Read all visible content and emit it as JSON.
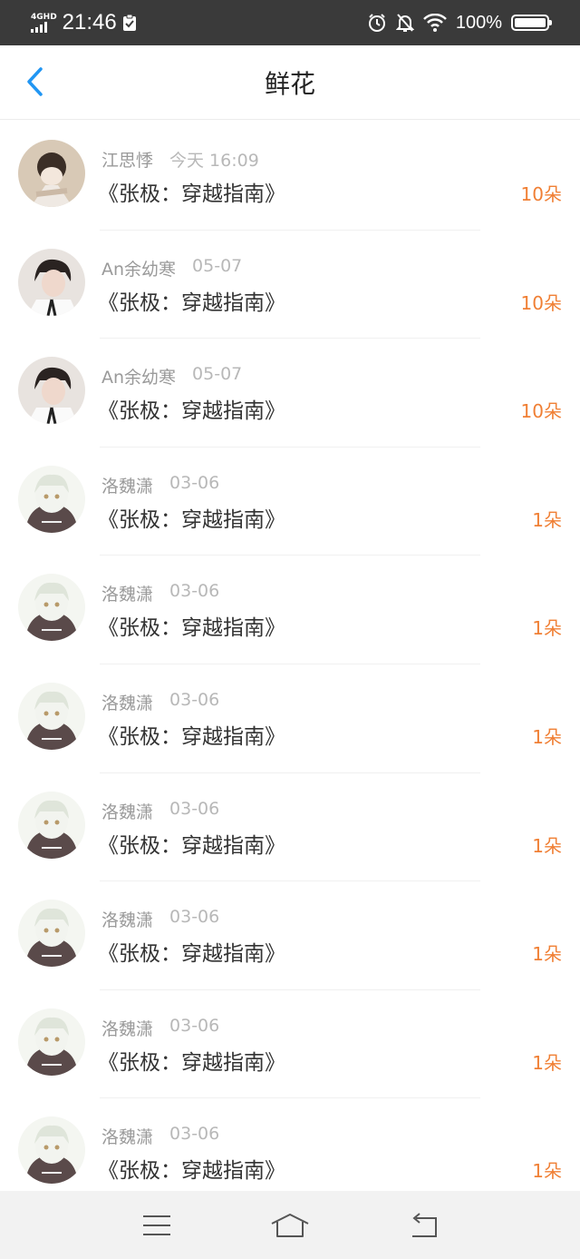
{
  "status_bar": {
    "network": "4G",
    "network_suffix": "HD",
    "time": "21:46",
    "battery": "100%"
  },
  "header": {
    "title": "鲜花"
  },
  "items": [
    {
      "user": "江思悸",
      "date": "今天 16:09",
      "book": "《张极：穿越指南》",
      "amount": "10朵",
      "avatar": "avatar-1"
    },
    {
      "user": "An余幼寒",
      "date": "05-07",
      "book": "《张极：穿越指南》",
      "amount": "10朵",
      "avatar": "avatar-2"
    },
    {
      "user": "An余幼寒",
      "date": "05-07",
      "book": "《张极：穿越指南》",
      "amount": "10朵",
      "avatar": "avatar-2"
    },
    {
      "user": "洛魏潇",
      "date": "03-06",
      "book": "《张极：穿越指南》",
      "amount": "1朵",
      "avatar": "avatar-3"
    },
    {
      "user": "洛魏潇",
      "date": "03-06",
      "book": "《张极：穿越指南》",
      "amount": "1朵",
      "avatar": "avatar-3"
    },
    {
      "user": "洛魏潇",
      "date": "03-06",
      "book": "《张极：穿越指南》",
      "amount": "1朵",
      "avatar": "avatar-3"
    },
    {
      "user": "洛魏潇",
      "date": "03-06",
      "book": "《张极：穿越指南》",
      "amount": "1朵",
      "avatar": "avatar-3"
    },
    {
      "user": "洛魏潇",
      "date": "03-06",
      "book": "《张极：穿越指南》",
      "amount": "1朵",
      "avatar": "avatar-3"
    },
    {
      "user": "洛魏潇",
      "date": "03-06",
      "book": "《张极：穿越指南》",
      "amount": "1朵",
      "avatar": "avatar-3"
    },
    {
      "user": "洛魏潇",
      "date": "03-06",
      "book": "《张极：穿越指南》",
      "amount": "1朵",
      "avatar": "avatar-3"
    }
  ],
  "colors": {
    "accent_blue": "#2196f3",
    "amount_orange": "#f07f34",
    "status_bar_bg": "#3a3a3a"
  },
  "icons": {
    "back": "chevron-left-icon",
    "alarm": "alarm-icon",
    "mute": "bell-off-icon",
    "wifi": "wifi-icon",
    "nav_menu": "menu-icon",
    "nav_home": "home-icon",
    "nav_back": "back-icon"
  }
}
